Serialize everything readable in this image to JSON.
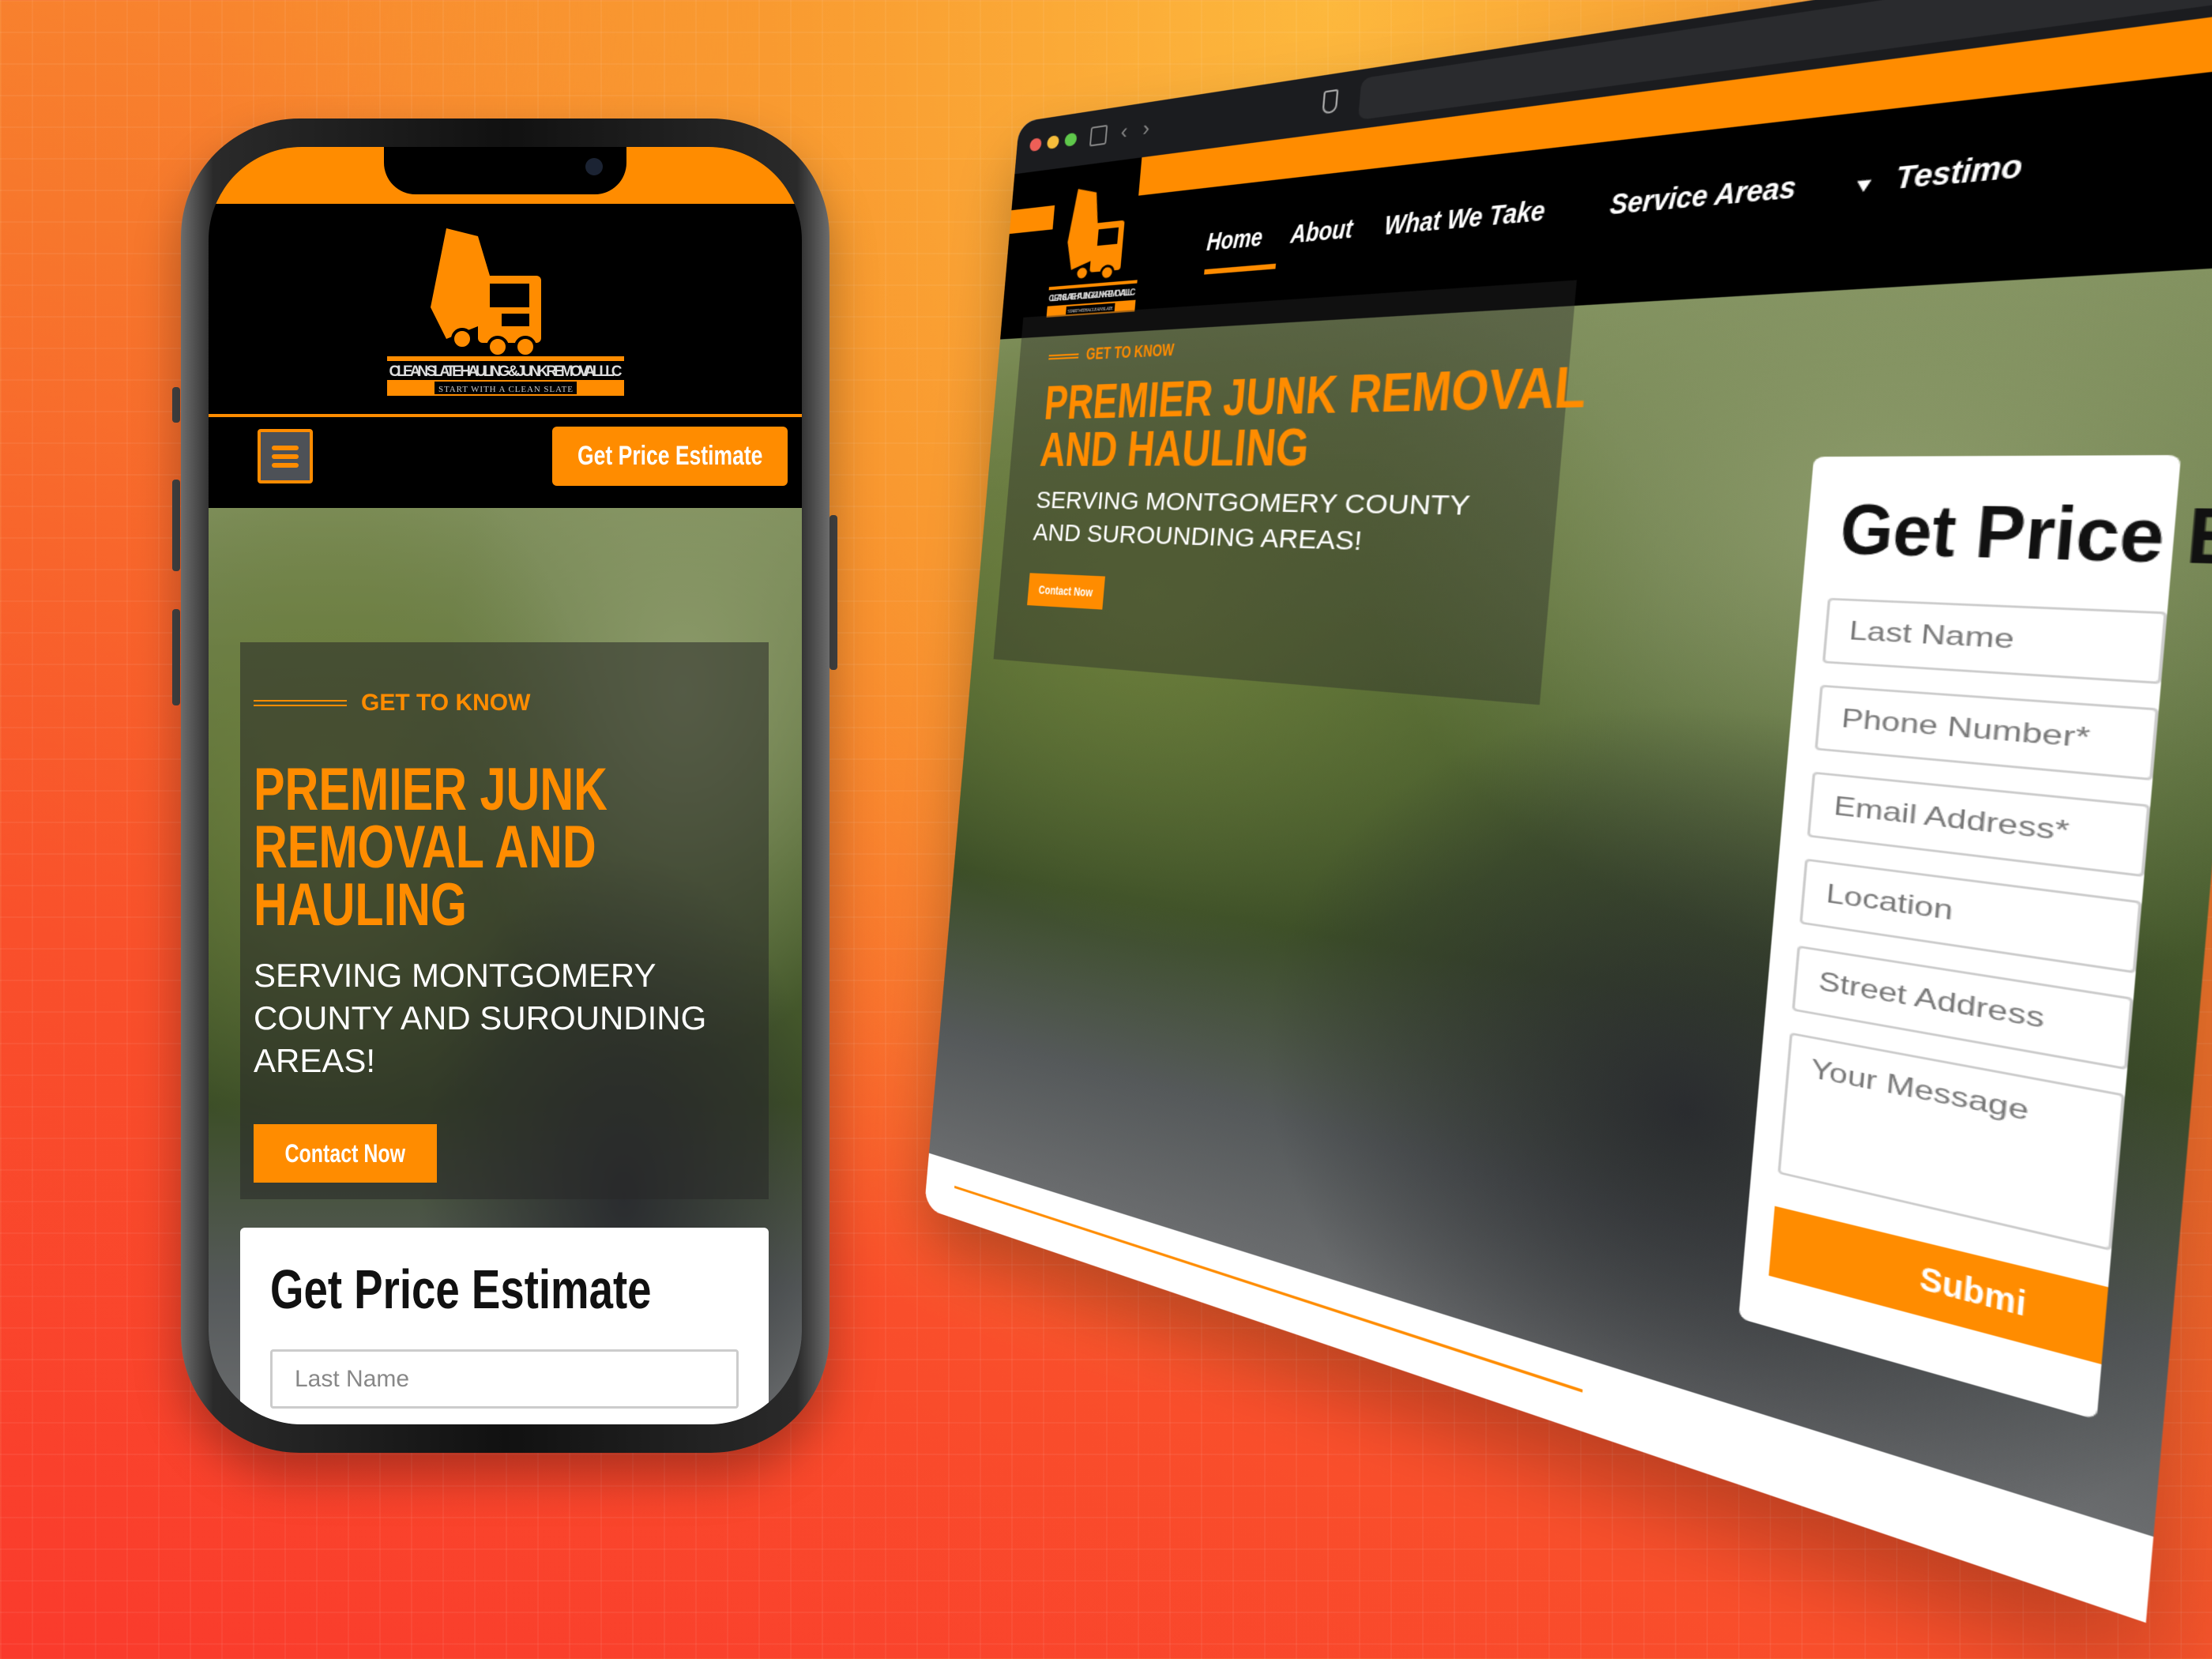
{
  "brand": {
    "name": "CLEAN SLATE HAULING & JUNK REMOVAL LLC",
    "tagline": "START WITH A CLEAN SLATE",
    "accent": "#ff8c00"
  },
  "mobile": {
    "header_cta": "Get Price Estimate",
    "menu_icon": "hamburger-icon",
    "hero": {
      "eyebrow": "GET TO KNOW",
      "title_lines": [
        "PREMIER JUNK",
        "REMOVAL AND",
        "HAULING"
      ],
      "subtitle": "SERVING MONTGOMERY COUNTY AND SUROUNDING AREAS!",
      "cta": "Contact Now"
    },
    "form": {
      "title": "Get Price Estimate",
      "fields": [
        {
          "placeholder": "Last Name"
        }
      ]
    }
  },
  "desktop": {
    "nav": [
      {
        "label": "Home",
        "active": true
      },
      {
        "label": "About"
      },
      {
        "label": "What We Take"
      },
      {
        "label": "Service Areas",
        "dropdown": true
      },
      {
        "label": "Testimo"
      }
    ],
    "hero": {
      "eyebrow": "GET TO KNOW",
      "title_lines": [
        "PREMIER JUNK REMOVAL",
        "AND HAULING"
      ],
      "subtitle": "SERVING MONTGOMERY COUNTY AND SUROUNDING AREAS!",
      "cta": "Contact Now"
    },
    "form": {
      "title": "Get Price Es",
      "fields": [
        {
          "placeholder": "Last Name"
        },
        {
          "placeholder": "Phone Number*"
        },
        {
          "placeholder": "Email Address*"
        },
        {
          "placeholder": "Location"
        },
        {
          "placeholder": "Street Address"
        },
        {
          "placeholder": "Your Message"
        }
      ],
      "submit": "Submi"
    }
  }
}
